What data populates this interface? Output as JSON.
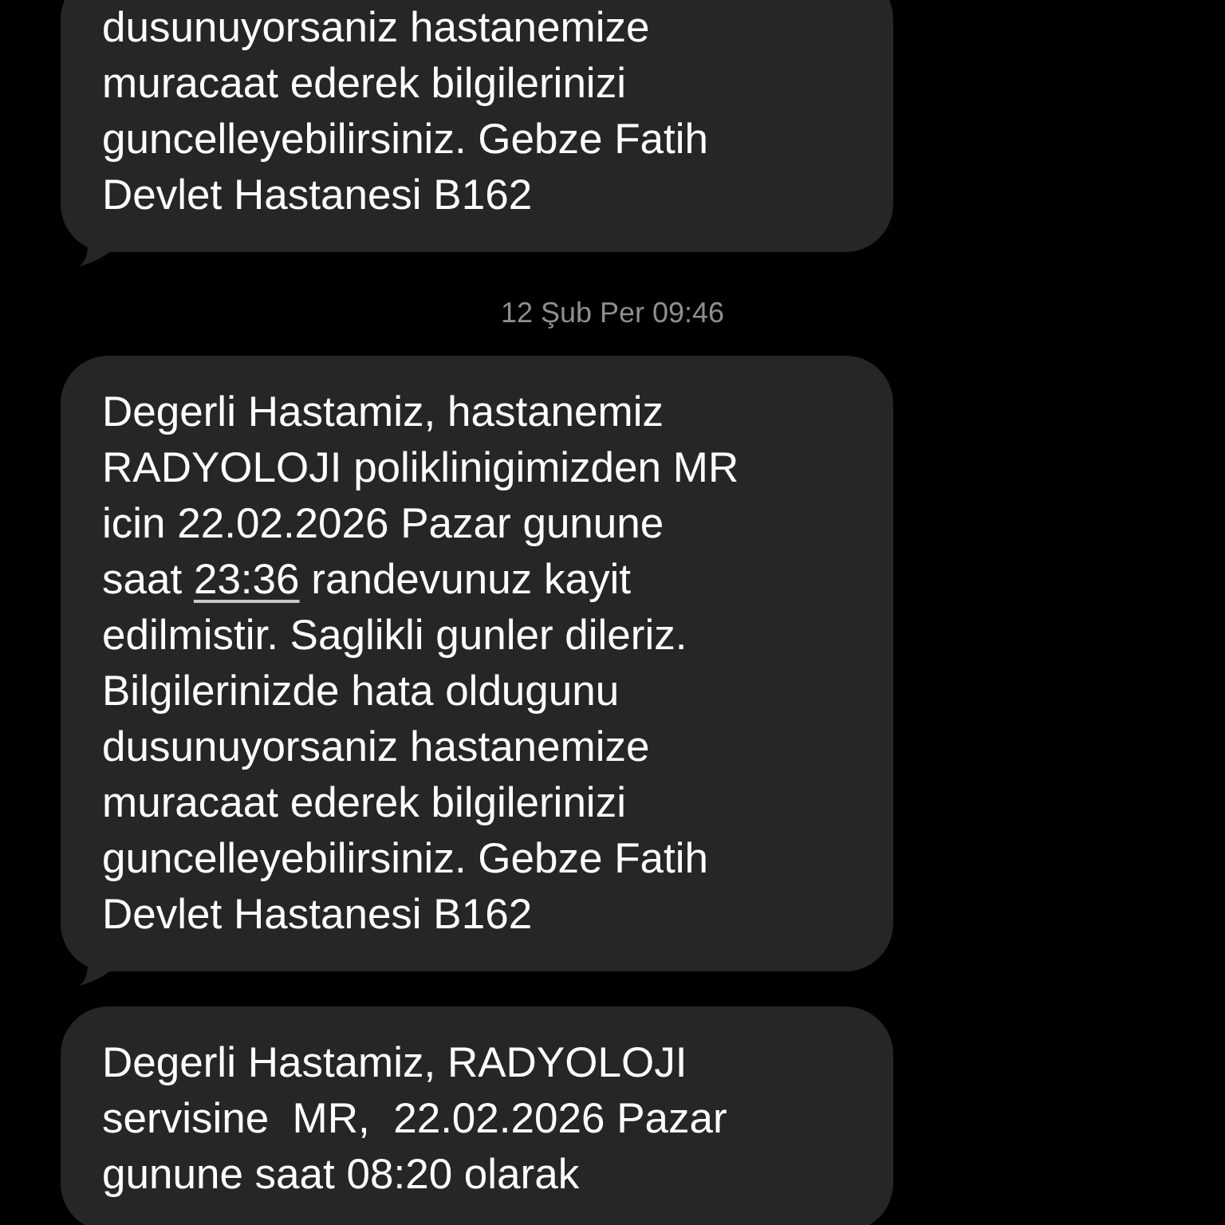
{
  "items": [
    {
      "kind": "message",
      "parts": [
        {
          "kind": "text",
          "text": "dusunuyorsaniz hastanemize\nmuracaat ederek bilgilerinizi\nguncelleyebilirsiniz. Gebze Fatih\nDevlet Hastanesi B162"
        }
      ]
    },
    {
      "kind": "timestamp",
      "text": "12 Şub Per 09:46"
    },
    {
      "kind": "message",
      "parts": [
        {
          "kind": "text",
          "text": "Degerli Hastamiz, hastanemiz\nRADYOLOJI poliklinigimizden MR\nicin 22.02.2026 Pazar gunune\nsaat "
        },
        {
          "kind": "link",
          "text": "23:36"
        },
        {
          "kind": "text",
          "text": " randevunuz kayit\nedilmistir. Saglikli gunler dileriz.\nBilgilerinizde hata oldugunu\ndusunuyorsaniz hastanemize\nmuracaat ederek bilgilerinizi\nguncelleyebilirsiniz. Gebze Fatih\nDevlet Hastanesi B162"
        }
      ]
    },
    {
      "kind": "message",
      "parts": [
        {
          "kind": "text",
          "text": "Degerli Hastamiz, RADYOLOJI\nservisine  MR,  22.02.2026 Pazar\ngunune saat 08:20 olarak"
        }
      ]
    }
  ]
}
